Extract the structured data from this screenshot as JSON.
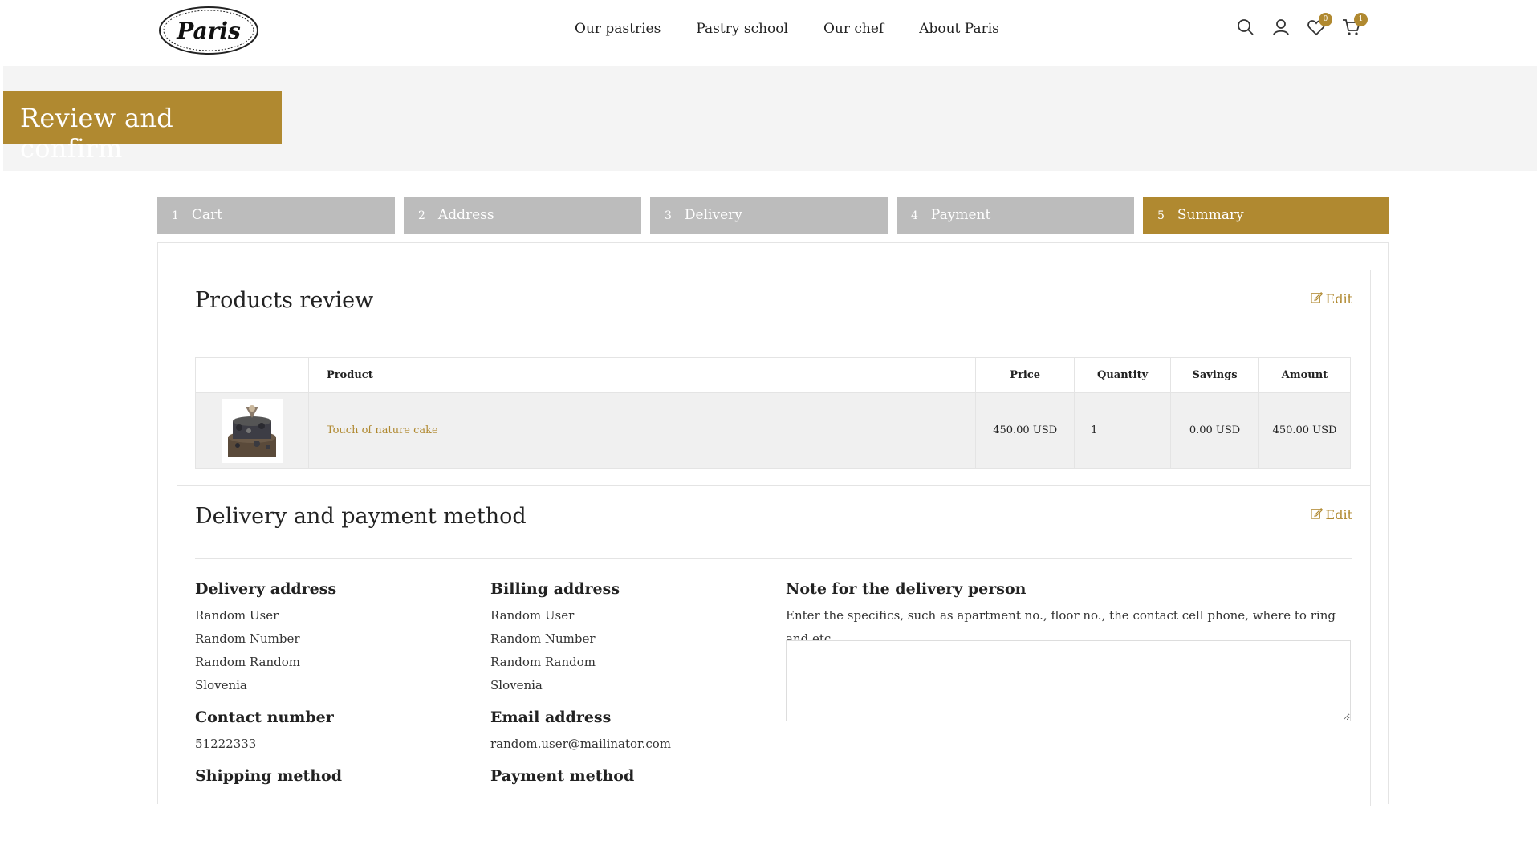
{
  "header": {
    "logo_text": "Paris",
    "nav": [
      "Our pastries",
      "Pastry school",
      "Our chef",
      "About Paris"
    ],
    "wishlist_count": "0",
    "cart_count": "1"
  },
  "page_title": "Review and confirm",
  "steps": [
    {
      "num": "1",
      "label": "Cart"
    },
    {
      "num": "2",
      "label": "Address"
    },
    {
      "num": "3",
      "label": "Delivery"
    },
    {
      "num": "4",
      "label": "Payment"
    },
    {
      "num": "5",
      "label": "Summary"
    }
  ],
  "products_review": {
    "title": "Products review",
    "edit_label": "Edit",
    "columns": [
      "Product",
      "Price",
      "Quantity",
      "Savings",
      "Amount"
    ],
    "rows": [
      {
        "product": "Touch of nature cake",
        "price": "450.00 USD",
        "quantity": "1",
        "savings": "0.00 USD",
        "amount": "450.00 USD"
      }
    ]
  },
  "delivery_payment": {
    "title": "Delivery and payment method",
    "edit_label": "Edit",
    "delivery_address": {
      "heading": "Delivery address",
      "lines": [
        "Random User",
        "Random Number",
        "Random Random",
        "Slovenia"
      ]
    },
    "billing_address": {
      "heading": "Billing address",
      "lines": [
        "Random User",
        "Random Number",
        "Random Random",
        "Slovenia"
      ]
    },
    "note": {
      "heading": "Note for the delivery person",
      "description": "Enter the specifics, such as apartment no., floor no., the contact cell phone, where to ring and etc.",
      "value": ""
    },
    "contact_number": {
      "heading": "Contact number",
      "value": "51222333"
    },
    "email_address": {
      "heading": "Email address",
      "value": "random.user@mailinator.com"
    },
    "shipping_method": {
      "heading": "Shipping method"
    },
    "payment_method": {
      "heading": "Payment method"
    }
  },
  "colors": {
    "accent": "#b08930",
    "step_inactive": "#bcbcbc",
    "band": "#f4f4f4"
  }
}
